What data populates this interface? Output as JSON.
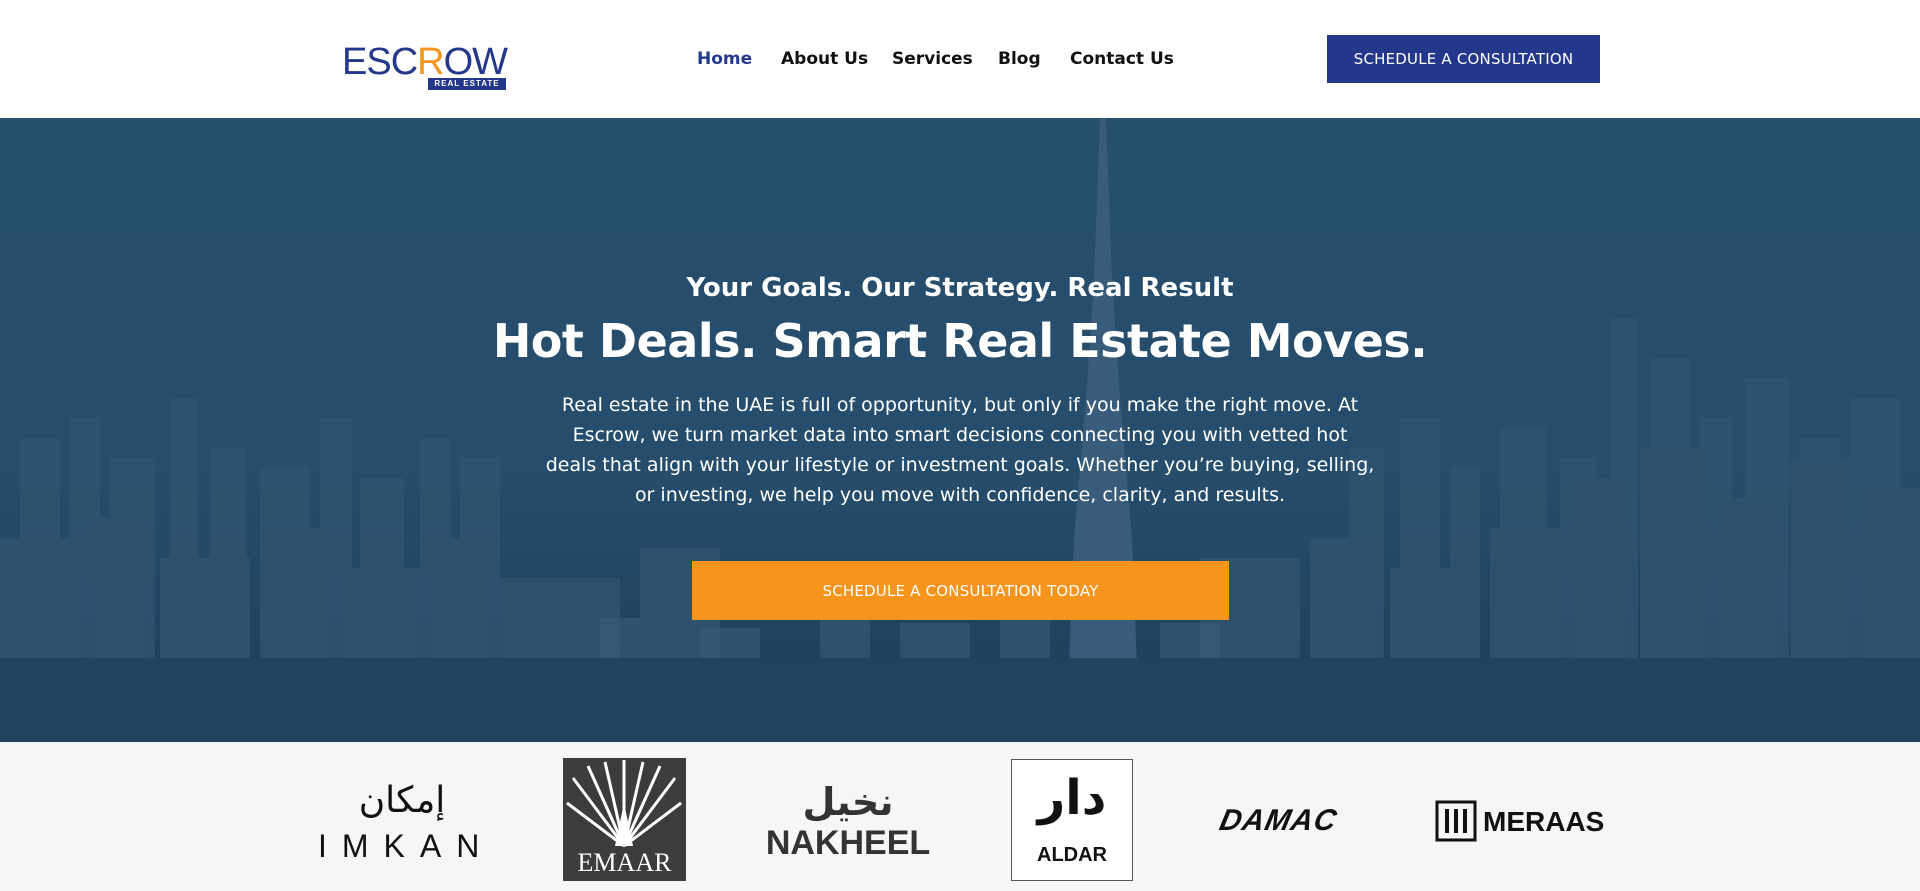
{
  "brand": {
    "logo_main": "ESCROW",
    "logo_sub": "REAL ESTATE",
    "accent_color": "#f7941d",
    "primary_color": "#23388a"
  },
  "nav": {
    "items": [
      {
        "label": "Home",
        "active": true
      },
      {
        "label": "About Us"
      },
      {
        "label": "Services"
      },
      {
        "label": "Blog"
      },
      {
        "label": "Contact Us"
      }
    ],
    "cta_label": "SCHEDULE A CONSULTATION"
  },
  "hero": {
    "subtitle": "Your Goals. Our Strategy. Real Result",
    "title": "Hot Deals. Smart Real Estate Moves.",
    "description": "Real estate in the UAE is full of opportunity, but only if you make the right move. At Escrow, we turn market data into smart decisions connecting you with vetted hot deals that align with your lifestyle or investment goals. Whether you’re buying, selling, or investing, we help you move with confidence, clarity, and results.",
    "cta_label": "SCHEDULE A CONSULTATION TODAY"
  },
  "partners": {
    "imkan": {
      "arabic": "إمكان",
      "english": "IMKAN"
    },
    "emaar": {
      "english": "EMAAR"
    },
    "nakheel": {
      "arabic": "نخيل",
      "english": "NAKHEEL"
    },
    "aldar": {
      "arabic": "دار",
      "english": "ALDAR"
    },
    "damac": {
      "english": "DAMAC"
    },
    "meraas": {
      "english": "MERAAS"
    }
  }
}
